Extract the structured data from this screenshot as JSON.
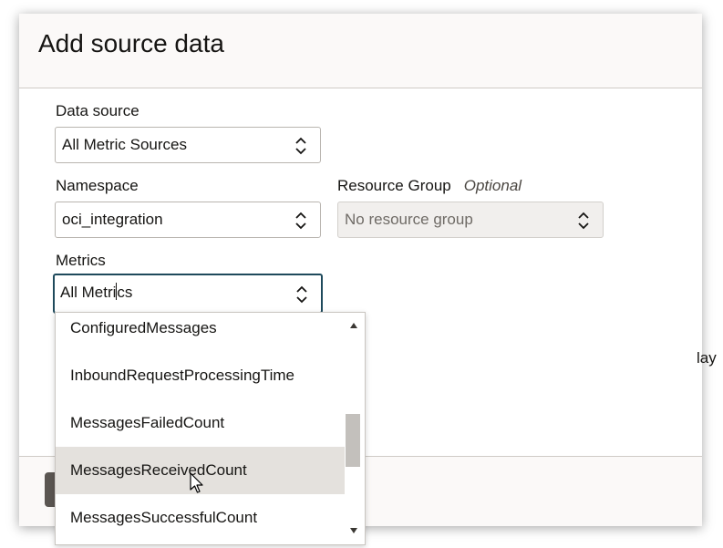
{
  "dialog": {
    "title": "Add source data"
  },
  "form": {
    "data_source": {
      "label": "Data source",
      "value": "All Metric Sources"
    },
    "namespace": {
      "label": "Namespace",
      "value": "oci_integration"
    },
    "resource_group": {
      "label": "Resource Group",
      "optional": "Optional",
      "value": "No resource group"
    },
    "metrics": {
      "label": "Metrics",
      "value_before_caret": "All Metri",
      "value_after_caret": "cs"
    }
  },
  "dropdown": {
    "items": [
      "ConfiguredMessages",
      "InboundRequestProcessingTime",
      "MessagesFailedCount",
      "MessagesReceivedCount",
      "MessagesSuccessfulCount"
    ],
    "hovered_item": "MessagesReceivedCount"
  },
  "background": {
    "peek_text": "lay"
  },
  "icons": {
    "select_chevron": "chevron-up-down-icon",
    "scroll_up": "triangle-up-icon",
    "scroll_down": "triangle-down-icon",
    "mouse": "mouse-pointer-icon"
  },
  "colors": {
    "focus_border": "#1f4a5c",
    "hover_bg": "#e4e1dd",
    "footer_button": "#5b5652"
  }
}
